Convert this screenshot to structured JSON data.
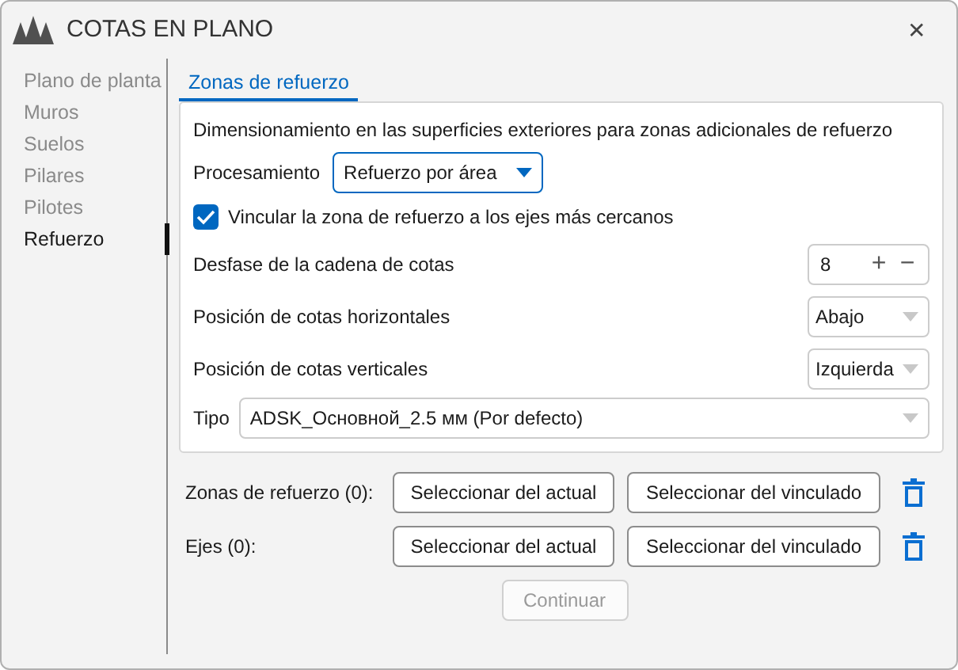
{
  "window": {
    "title": "COTAS EN PLANO",
    "close": "✕"
  },
  "sidebar": {
    "items": [
      {
        "label": "Plano de planta",
        "selected": false
      },
      {
        "label": "Muros",
        "selected": false
      },
      {
        "label": "Suelos",
        "selected": false
      },
      {
        "label": "Pilares",
        "selected": false
      },
      {
        "label": "Pilotes",
        "selected": false
      },
      {
        "label": "Refuerzo",
        "selected": true
      }
    ]
  },
  "tabs": [
    {
      "label": "Zonas de refuerzo",
      "selected": true
    }
  ],
  "panel": {
    "description": "Dimensionamiento en las superficies exteriores para zonas adicionales de refuerzo",
    "processing": {
      "label": "Procesamiento",
      "value": "Refuerzo por área",
      "focused": true
    },
    "link_option": {
      "label": "Vincular la zona de refuerzo a los ejes más cercanos",
      "checked": true
    },
    "rows": [
      {
        "kind": "stepper",
        "label": "Desfase de la cadena de cotas",
        "value": "8",
        "plus": "+",
        "minus": "−"
      },
      {
        "kind": "dropdown",
        "label": "Posición de cotas horizontales",
        "value": "Abajo"
      },
      {
        "kind": "dropdown",
        "label": "Posición de cotas verticales",
        "value": "Izquierda"
      }
    ],
    "type": {
      "label": "Tipo",
      "value": "ADSK_Основной_2.5 мм (Por defecto)"
    }
  },
  "selections": [
    {
      "label": "Zonas de refuerzo (0):",
      "buttons": [
        "Seleccionar del actual",
        "Seleccionar del vinculado"
      ]
    },
    {
      "label": "Ejes (0):",
      "buttons": [
        "Seleccionar del actual",
        "Seleccionar del vinculado"
      ]
    }
  ],
  "continue_button": {
    "label": "Continuar",
    "disabled": true
  }
}
